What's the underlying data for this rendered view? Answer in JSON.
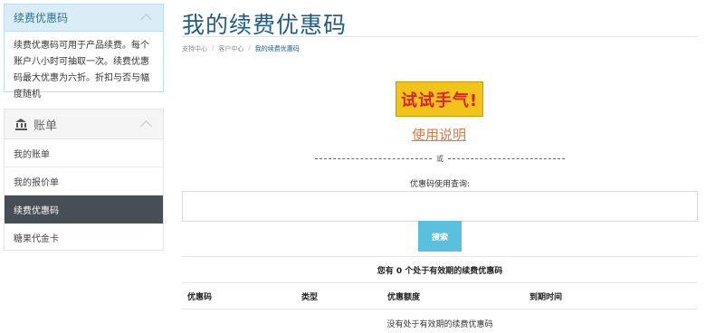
{
  "sidebar": {
    "info_panel": {
      "title": "续费优惠码",
      "body": "续费优惠码可用于产品续费。每个账户八小时可抽取一次。续费优惠码最大优惠为六折。折扣与否与幅度随机"
    },
    "billing_panel": {
      "title": "账单",
      "icon": "bank-icon",
      "items": [
        {
          "label": "我的账单",
          "active": false
        },
        {
          "label": "我的报价单",
          "active": false
        },
        {
          "label": "续费优惠码",
          "active": true
        },
        {
          "label": "糖果代金卡",
          "active": false
        }
      ]
    }
  },
  "main": {
    "title": "我的续费优惠码",
    "breadcrumb": [
      "支持中心",
      "客户中心",
      "我的续费优惠码"
    ],
    "try_button": "试试手气!",
    "usage_link": "使用说明",
    "or_text": "或",
    "query_label": "优惠码使用查询:",
    "query_input_value": "",
    "search_button": "搜索",
    "active_count_text": "您有 0 个处于有效期的续费优惠码",
    "table_headers": [
      "优惠码",
      "类型",
      "优惠额度",
      "到期时间"
    ],
    "empty_text": "没有处于有效期的续费优惠码"
  },
  "colors": {
    "title_blue": "#1f5d86",
    "info_panel_bg": "#d9edf7",
    "active_menu_bg": "#474e55",
    "try_button_bg": "#f2c318",
    "try_button_text": "#d9262d",
    "link_orange": "#e07a44",
    "search_button_bg": "#5bc0de"
  }
}
